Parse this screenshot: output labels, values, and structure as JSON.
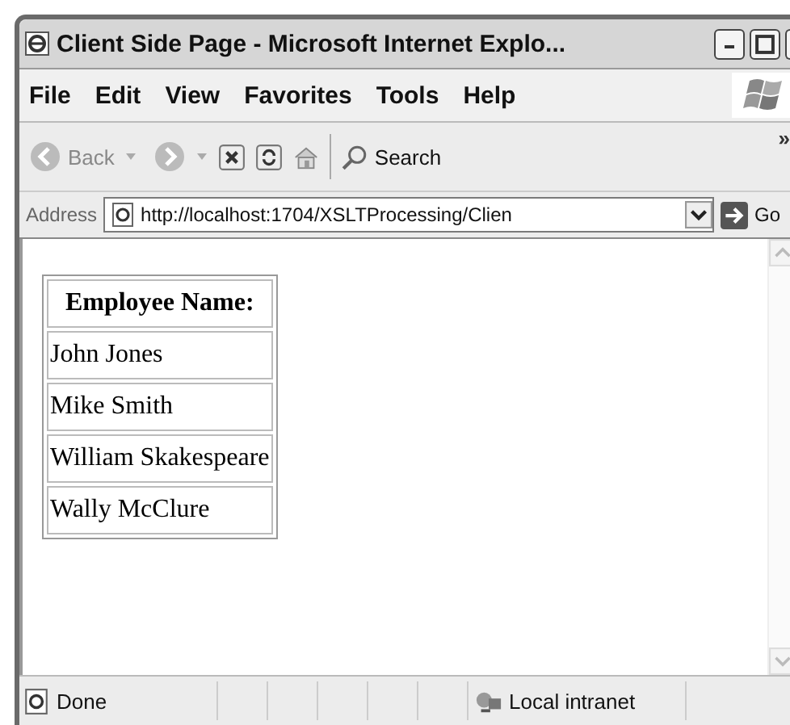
{
  "window": {
    "title": "Client Side Page - Microsoft Internet Explo..."
  },
  "menu": [
    {
      "label": "File"
    },
    {
      "label": "Edit"
    },
    {
      "label": "View"
    },
    {
      "label": "Favorites"
    },
    {
      "label": "Tools"
    },
    {
      "label": "Help"
    }
  ],
  "toolbar": {
    "back": "Back",
    "search": "Search",
    "more": "»"
  },
  "address": {
    "label": "Address",
    "value": "http://localhost:1704/XSLTProcessing/Clien",
    "go": "Go"
  },
  "table": {
    "header": "Employee Name:",
    "rows": [
      "John Jones",
      "Mike Smith",
      "William Skakespeare",
      "Wally McClure"
    ]
  },
  "status_bar": {
    "text": "Done",
    "zone": "Local intranet"
  }
}
